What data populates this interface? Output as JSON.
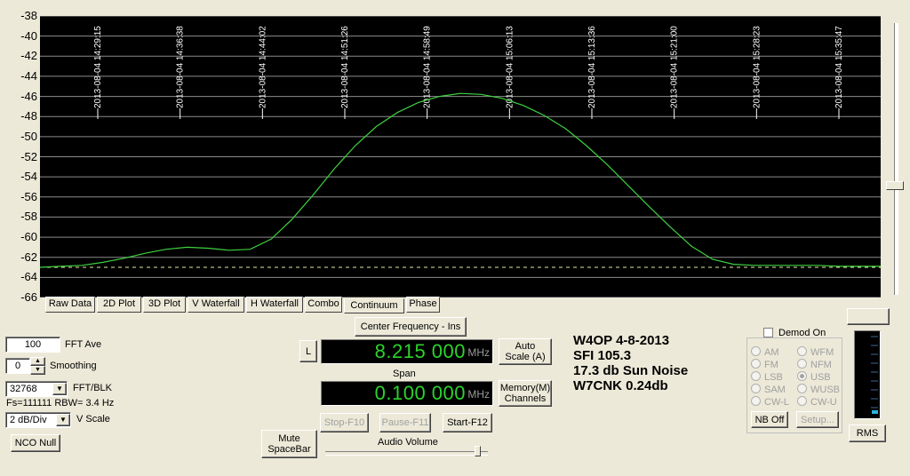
{
  "y_axis": {
    "ticks": [
      "-38",
      "-40",
      "-42",
      "-44",
      "-46",
      "-48",
      "-50",
      "-52",
      "-54",
      "-56",
      "-58",
      "-60",
      "-62",
      "-64",
      "-66"
    ]
  },
  "time_markers": [
    "2013-08-04 14:29:15",
    "2013-08-04 14:36:38",
    "2013-08-04 14:44:02",
    "2013-08-04 14:51:26",
    "2013-08-04 14:58:49",
    "2013-08-04 15:06:13",
    "2013-08-04 15:13:36",
    "2013-08-04 15:21:00",
    "2013-08-04 15:28:23",
    "2013-08-04 15:35:47"
  ],
  "tabs": [
    "Raw Data",
    "2D Plot",
    "3D Plot",
    "V Waterfall",
    "H Waterfall",
    "Combo",
    "Continuum",
    "Phase"
  ],
  "active_tab": "Continuum",
  "left_panel": {
    "fft_ave_value": "100",
    "fft_ave_label": "FFT Ave",
    "smoothing_value": "0",
    "smoothing_label": "Smoothing",
    "fft_blk_value": "32768",
    "fft_blk_label": "FFT/BLK",
    "fs_info": "Fs=111111 RBW= 3.4 Hz",
    "vscale_value": "2 dB/Div",
    "vscale_label": "V Scale",
    "nco_null": "NCO Null"
  },
  "center": {
    "center_freq_button": "Center Frequency - Ins",
    "l_button": "L",
    "frequency": "8.215 000",
    "freq_unit": "MHz",
    "auto_scale": "Auto Scale (A)",
    "span_label": "Span",
    "span": "0.100 000",
    "span_unit": "MHz",
    "memory_channels": "Memory(M) Channels",
    "stop": "Stop-F10",
    "pause": "Pause-F11",
    "start": "Start-F12",
    "mute": "Mute SpaceBar",
    "audio_volume": "Audio Volume"
  },
  "notes": [
    "W4OP  4-8-2013",
    "SFI 105.3",
    "17.3 db Sun Noise",
    "W7CNK 0.24db"
  ],
  "demod": {
    "checkbox_label": "Demod On",
    "modes_left": [
      "AM",
      "FM",
      "LSB",
      "SAM",
      "CW-L"
    ],
    "modes_right": [
      "WFM",
      "NFM",
      "USB",
      "WUSB",
      "CW-U"
    ],
    "selected": "USB",
    "nb_off": "NB Off",
    "setup": "Setup..."
  },
  "rms_button": "RMS",
  "chart_data": {
    "type": "line",
    "ylim": [
      -66,
      -38
    ],
    "grid": true,
    "series": [
      {
        "values": [
          -63,
          -62.9,
          -62.8,
          -62.5,
          -62.1,
          -61.6,
          -61.2,
          -61,
          -61.1,
          -61.3,
          -61.2,
          -60.2,
          -58.2,
          -55.8,
          -53.2,
          -50.9,
          -49,
          -47.6,
          -46.6,
          -46,
          -45.7,
          -45.8,
          -46.2,
          -46.9,
          -47.9,
          -49.2,
          -50.9,
          -52.8,
          -54.9,
          -57,
          -59,
          -60.9,
          -62.2,
          -62.7,
          -62.8,
          -62.8,
          -62.8,
          -62.8,
          -62.9,
          -62.9,
          -62.9
        ]
      }
    ],
    "reference_level": -63
  }
}
